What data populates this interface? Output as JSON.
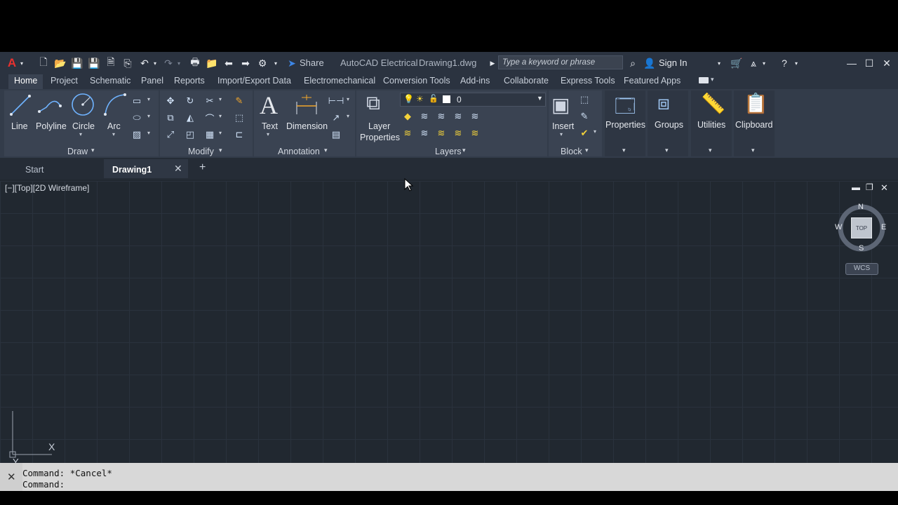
{
  "titlebar": {
    "share_label": "Share",
    "app_name": "AutoCAD Electrical",
    "file_name": "Drawing1.dwg",
    "search_placeholder": "Type a keyword or phrase",
    "sign_in_label": "Sign In"
  },
  "ribbon_tabs": [
    "Home",
    "Project",
    "Schematic",
    "Panel",
    "Reports",
    "Import/Export Data",
    "Electromechanical",
    "Conversion Tools",
    "Add-ins",
    "Collaborate",
    "Express Tools",
    "Featured Apps"
  ],
  "draw": {
    "line": "Line",
    "polyline": "Polyline",
    "circle": "Circle",
    "arc": "Arc",
    "title": "Draw"
  },
  "modify": {
    "title": "Modify"
  },
  "annotation": {
    "text": "Text",
    "dimension": "Dimension",
    "title": "Annotation"
  },
  "layers": {
    "layer_properties_1": "Layer",
    "layer_properties_2": "Properties",
    "current_layer": "0",
    "title": "Layers"
  },
  "block": {
    "insert": "Insert",
    "title": "Block"
  },
  "extra": {
    "properties": "Properties",
    "groups": "Groups",
    "utilities": "Utilities",
    "clipboard": "Clipboard"
  },
  "filetabs": {
    "start": "Start",
    "drawing": "Drawing1"
  },
  "viewport": {
    "label": "[−][Top][2D Wireframe]"
  },
  "viewcube": {
    "n": "N",
    "s": "S",
    "e": "E",
    "w": "W",
    "top": "TOP",
    "wcs": "WCS"
  },
  "ucs": {
    "x": "X",
    "y": "Y"
  },
  "command": {
    "line1": "Command: *Cancel*",
    "line2": "Command:"
  },
  "colors": {
    "accent": "#3d86e6",
    "ribbon": "#3a4352",
    "canvas": "#212830",
    "autocad_red": "#e8312f"
  }
}
